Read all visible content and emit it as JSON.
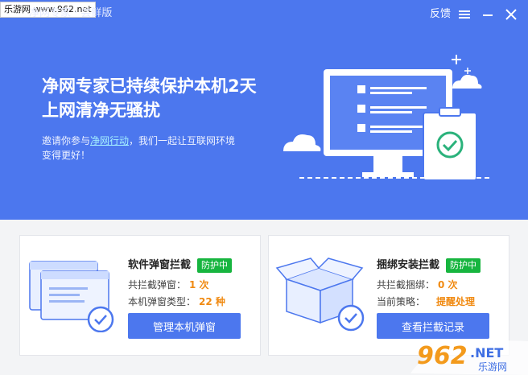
{
  "watermark_top": "乐游网 www.962.net",
  "titlebar": {
    "app_title": "净网专家 · 尝鲜版",
    "feedback_label": "反馈"
  },
  "hero": {
    "headline_line1": "净网专家已持续保护本机2天",
    "headline_line2": "上网清净无骚扰",
    "sub_prefix": "邀请你参与",
    "sub_link": "净网行动",
    "sub_suffix": "，我们一起让互联网环境",
    "sub_line2": "变得更好！"
  },
  "cards": {
    "popup": {
      "title": "软件弹窗拦截",
      "badge": "防护中",
      "stat1_label": "共拦截弹窗：",
      "stat1_value": "1 次",
      "stat2_label": "本机弹窗类型：",
      "stat2_value": "22 种",
      "button": "管理本机弹窗"
    },
    "bundle": {
      "title": "捆绑安装拦截",
      "badge": "防护中",
      "stat1_label": "共拦截捆绑：",
      "stat1_value": "0 次",
      "stat2_label": "当前策略：",
      "stat2_value": "提醒处理",
      "button": "查看拦截记录"
    }
  },
  "watermark_logo": {
    "number": "962",
    "suffix": ".NET",
    "caption": "乐游网"
  },
  "colors": {
    "brand_blue": "#4c77ee",
    "badge_green": "#17b53f",
    "stat_orange": "#f08a12"
  }
}
